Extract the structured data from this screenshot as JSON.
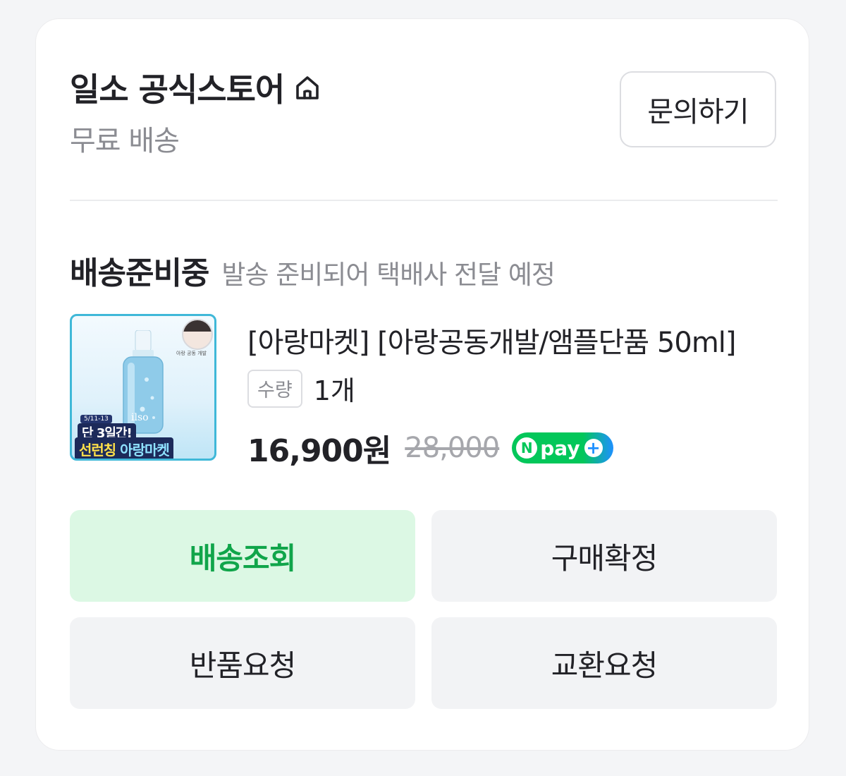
{
  "store": {
    "name": "일소 공식스토어",
    "shipping": "무료 배송",
    "inquiry_label": "문의하기"
  },
  "order": {
    "status_title": "배송준비중",
    "status_desc": "발송 준비되어 택배사 전달 예정",
    "product": {
      "title": "[아랑마켓] [아랑공동개발/앰플단품 50ml] ",
      "thumbnail": {
        "date": "5/11-13",
        "line1": "단 3일간!",
        "line2a": "선런칭",
        "line2b": "아랑마켓",
        "brand": "ilso",
        "face_tag": "아랑 공동 개발"
      },
      "qty_label": "수량",
      "qty_value": "1개",
      "price": "16,900원",
      "original_price": "28,000",
      "pay_badge": "pay"
    }
  },
  "actions": {
    "track": "배송조회",
    "confirm": "구매확정",
    "return": "반품요청",
    "exchange": "교환요청"
  },
  "colors": {
    "accent_green": "#10a54a",
    "track_bg": "#dcf8e4",
    "npay_green": "#03c75a"
  }
}
